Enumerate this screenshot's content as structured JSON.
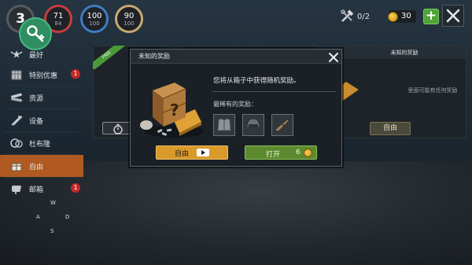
{
  "hud": {
    "level": "3",
    "health": {
      "current": "71",
      "max": "84"
    },
    "food": {
      "current": "100",
      "max": "100"
    },
    "water": {
      "current": "90",
      "max": "100"
    },
    "tools_count": "0/2",
    "coins": "30",
    "plus_label": "+"
  },
  "sidebar": {
    "items": [
      {
        "label": "最好",
        "icon": "wings-star-icon",
        "badge": ""
      },
      {
        "label": "特别优惠",
        "icon": "crate-icon",
        "badge": "1"
      },
      {
        "label": "资源",
        "icon": "logs-icon",
        "badge": ""
      },
      {
        "label": "设备",
        "icon": "arrows-icon",
        "badge": ""
      },
      {
        "label": "杜布隆",
        "icon": "coins-icon",
        "badge": ""
      },
      {
        "label": "自由",
        "icon": "gift-icon",
        "badge": ""
      },
      {
        "label": "邮箱",
        "icon": "mailbox-icon",
        "badge": "1"
      }
    ],
    "active_index": 5
  },
  "controls": {
    "w": "W",
    "a": "A",
    "s": "S",
    "d": "D"
  },
  "background": {
    "free_ribbon": "FREE",
    "right_card_title": "未知的奖励",
    "right_card_text": "里面可能有任何奖励",
    "right_card_button": "自由"
  },
  "modal": {
    "title": "未知的奖励",
    "description": "您将从箱子中获得随机奖励。",
    "rarest_label": "最稀有的奖励：",
    "rewards": [
      "armor-vest-icon",
      "helmet-icon",
      "rifle-icon"
    ],
    "free_button": "自由",
    "open_button": "打开",
    "open_cost": "6"
  },
  "colors": {
    "accent_orange": "#b05a22",
    "free_button": "#d99a2c",
    "open_button": "#5b8a2e",
    "hp_ring": "#c63d3d",
    "food_ring": "#3e7cc5",
    "water_ring": "#c8a873"
  }
}
